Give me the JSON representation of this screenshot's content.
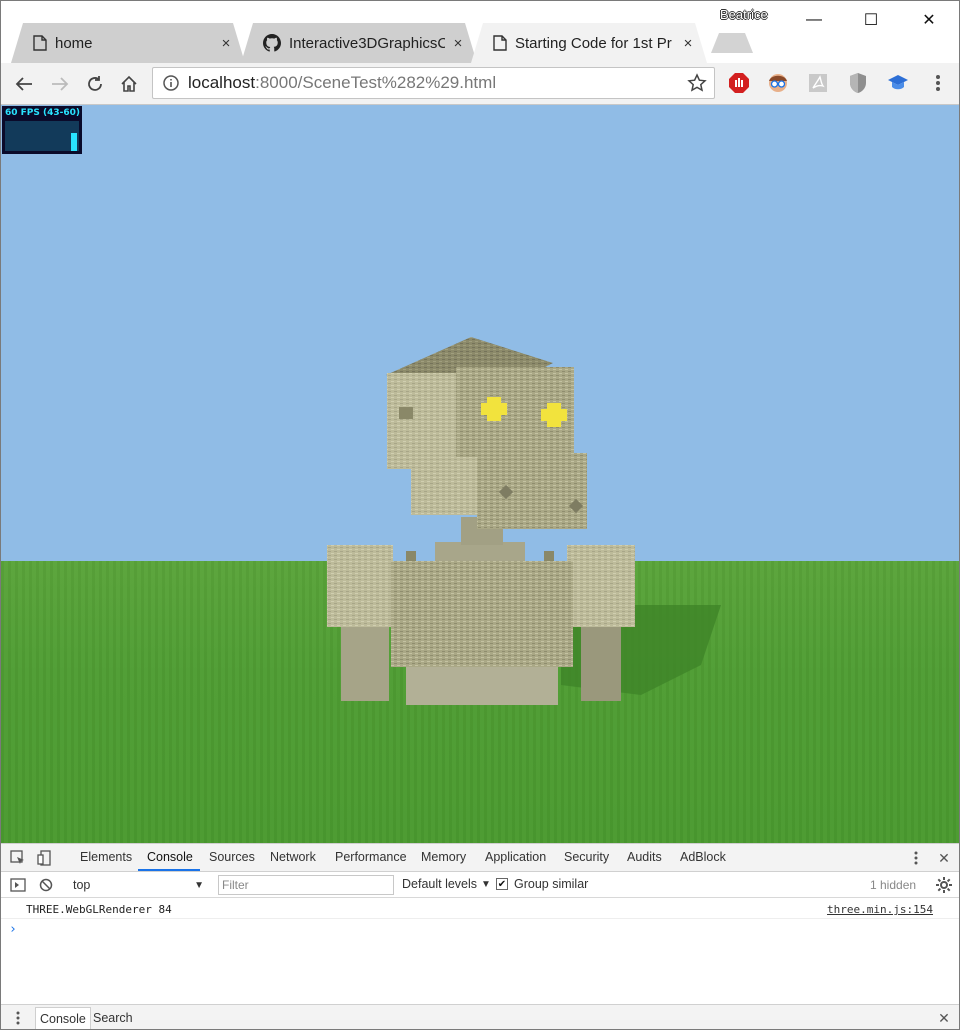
{
  "browser": {
    "profile_name": "Beatrice",
    "tabs": [
      {
        "label": "home",
        "icon": "page-icon",
        "close": "×"
      },
      {
        "label": "Interactive3DGraphicsC",
        "icon": "github-icon",
        "close": "×"
      },
      {
        "label": "Starting Code for 1st Pr",
        "icon": "page-icon",
        "close": "×"
      }
    ],
    "window_controls": {
      "minimize": "—",
      "maximize": "☐",
      "close": "✕"
    }
  },
  "toolbar": {
    "url_host": "localhost",
    "url_rest": ":8000/SceneTest%282%29.html",
    "extensions": [
      "adblock-icon",
      "avatar-glasses-icon",
      "pdf-icon",
      "shield-icon",
      "graduation-cap-icon",
      "menu-dots-icon"
    ]
  },
  "viewport": {
    "fps_text": "60 FPS (43-60)",
    "fps_level": 0.6,
    "colors": {
      "sky": "#90bce6",
      "grass": "#4f9d33",
      "stone": "#b4b28e",
      "eyes": "#f2e33d"
    }
  },
  "devtools": {
    "tabs": [
      "Elements",
      "Console",
      "Sources",
      "Network",
      "Performance",
      "Memory",
      "Application",
      "Security",
      "Audits",
      "AdBlock"
    ],
    "active_tab": "Console",
    "context": "top",
    "filter_placeholder": "Filter",
    "levels_label": "Default levels",
    "levels_caret": "▼",
    "group_similar_label": "Group similar",
    "group_similar_checked": "✔",
    "hidden_count": "1 hidden",
    "messages": [
      {
        "text": "THREE.WebGLRenderer 84",
        "source": "three.min.js:154"
      }
    ],
    "prompt": "›",
    "drawer_tabs": [
      "Console",
      "Search"
    ],
    "drawer_close": "✕",
    "close": "✕"
  }
}
